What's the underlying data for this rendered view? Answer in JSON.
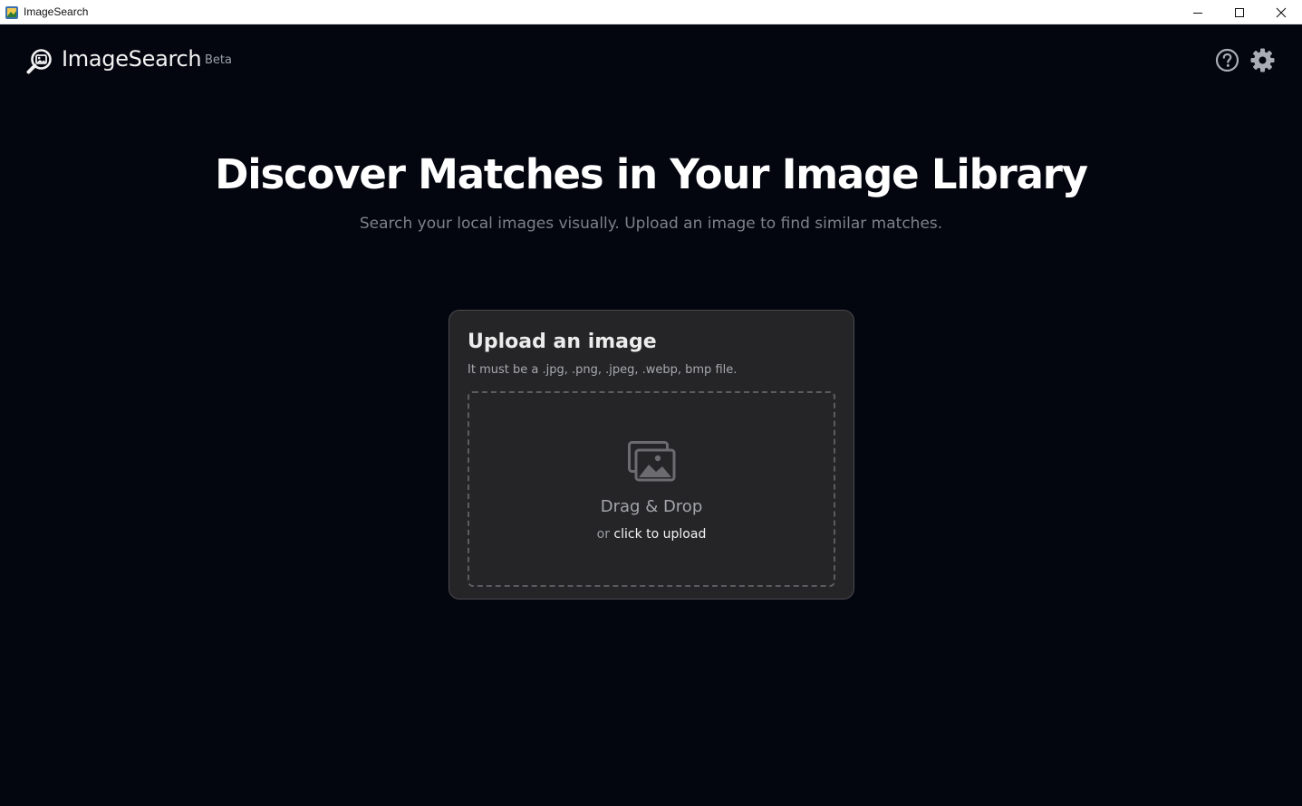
{
  "window": {
    "title": "ImageSearch",
    "minimize_icon": "minimize-icon",
    "maximize_icon": "maximize-icon",
    "close_icon": "close-icon"
  },
  "header": {
    "brand": "ImageSearch",
    "badge": "Beta",
    "logo_icon": "magnifier-image-icon",
    "help_icon": "help-circle-icon",
    "settings_icon": "gear-icon"
  },
  "hero": {
    "title": "Discover Matches in Your Image Library",
    "subtitle": "Search your local images visually. Upload an image to find similar matches."
  },
  "upload": {
    "title": "Upload an image",
    "hint": "It must be a .jpg, .png, .jpeg, .webp, bmp file.",
    "drop_icon": "images-icon",
    "drop_title": "Drag & Drop",
    "drop_prefix": "or",
    "drop_link": "click to upload"
  },
  "colors": {
    "background": "#03060f",
    "card": "#252527",
    "card_border": "#4a4a4e",
    "text_primary": "#ffffff",
    "text_muted": "#7c818a"
  }
}
